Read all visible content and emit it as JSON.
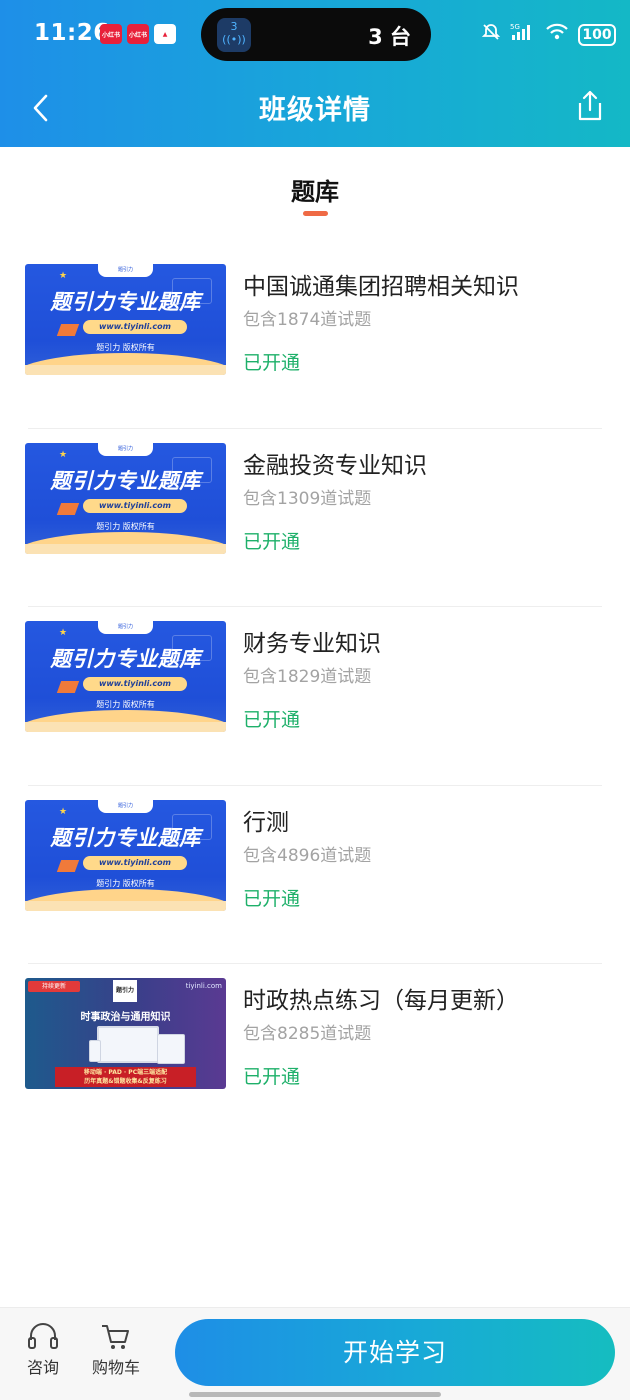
{
  "status_bar": {
    "time": "11:26",
    "mini_apps": [
      "小红书",
      "小红书",
      "▲"
    ],
    "island_badge": "3",
    "island_text": "3 台",
    "network": "5G",
    "battery": "100"
  },
  "nav": {
    "title": "班级详情"
  },
  "section": {
    "title": "题库"
  },
  "thumb_blue": {
    "tab": "题引力",
    "main": "题引力专业题库",
    "url": "www.tiyinli.com",
    "copyright": "题引力 版权所有"
  },
  "thumb_purple": {
    "badge": "持续更新",
    "logo": "题引力",
    "site": "tiyinli.com",
    "title": "时事政治与通用知识",
    "bar_line1": "移动端 · PAD · PC端三端适配",
    "bar_line2": "历年真题&错题收集&反复练习"
  },
  "items": [
    {
      "title": "中国诚通集团招聘相关知识",
      "count": "包含1874道试题",
      "status": "已开通"
    },
    {
      "title": "金融投资专业知识",
      "count": "包含1309道试题",
      "status": "已开通"
    },
    {
      "title": "财务专业知识",
      "count": "包含1829道试题",
      "status": "已开通"
    },
    {
      "title": "行测",
      "count": "包含4896道试题",
      "status": "已开通"
    },
    {
      "title": "时政热点练习（每月更新）",
      "count": "包含8285道试题",
      "status": "已开通"
    }
  ],
  "bottom_bar": {
    "consult_label": "咨询",
    "cart_label": "购物车",
    "start_label": "开始学习"
  },
  "colors": {
    "header_gradient_start": "#1e8fe8",
    "header_gradient_end": "#14b8c6",
    "status_green": "#1eb06a",
    "underline_accent": "#ef6a45"
  }
}
